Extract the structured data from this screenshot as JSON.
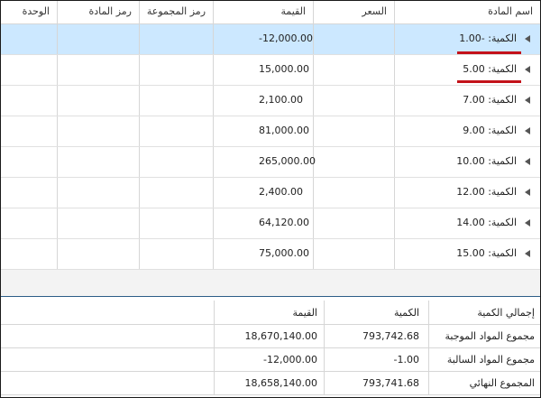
{
  "columns": {
    "name": "اسم المادة",
    "price": "السعر",
    "value": "القيمة",
    "group_code": "رمز المجموعة",
    "item_code": "رمز المادة",
    "unit": "الوحدة"
  },
  "rows": [
    {
      "label": "الكمية: -1.00",
      "value": "-12,000.00",
      "selected": true
    },
    {
      "label": "الكمية: 5.00",
      "value": "15,000.00",
      "selected": false
    },
    {
      "label": "الكمية: 7.00",
      "value": "2,100.00",
      "selected": false
    },
    {
      "label": "الكمية: 9.00",
      "value": "81,000.00",
      "selected": false
    },
    {
      "label": "الكمية: 10.00",
      "value": "265,000.00",
      "selected": false
    },
    {
      "label": "الكمية: 12.00",
      "value": "2,400.00",
      "selected": false
    },
    {
      "label": "الكمية: 14.00",
      "value": "64,120.00",
      "selected": false
    },
    {
      "label": "الكمية: 15.00",
      "value": "75,000.00",
      "selected": false
    }
  ],
  "summary": {
    "headers": {
      "label": "إجمالي الكمية",
      "quantity": "الكمية",
      "value": "القيمة"
    },
    "rows": [
      {
        "label": "مجموع المواد الموجبة",
        "quantity": "793,742.68",
        "value": "18,670,140.00"
      },
      {
        "label": "مجموع المواد السالبة",
        "quantity": "-1.00",
        "value": "-12,000.00"
      },
      {
        "label": "المجموع النهائي",
        "quantity": "793,741.68",
        "value": "18,658,140.00"
      }
    ]
  },
  "colors": {
    "selected_row": "#cce8ff",
    "annotation_underline": "#c3121a",
    "expand_arrow": "#555555"
  },
  "icons": {
    "row_expand": "triangle-left-icon"
  }
}
